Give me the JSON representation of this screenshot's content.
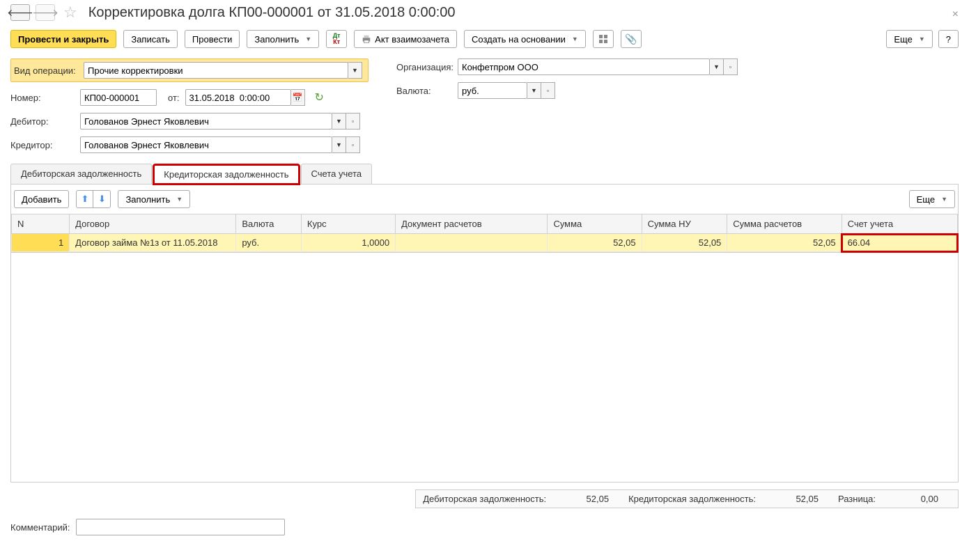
{
  "header": {
    "title": "Корректировка долга КП00-000001 от 31.05.2018 0:00:00"
  },
  "toolbar": {
    "post_close": "Провести и закрыть",
    "save": "Записать",
    "post": "Провести",
    "fill": "Заполнить",
    "offset_act": "Акт взаимозачета",
    "create_based": "Создать на основании",
    "more": "Еще",
    "help": "?"
  },
  "form": {
    "operation_type_label": "Вид операции:",
    "operation_type": "Прочие корректировки",
    "number_label": "Номер:",
    "number": "КП00-000001",
    "date_label": "от:",
    "date": "31.05.2018  0:00:00",
    "debtor_label": "Дебитор:",
    "debtor": "Голованов Эрнест Яковлевич",
    "creditor_label": "Кредитор:",
    "creditor": "Голованов Эрнест Яковлевич",
    "org_label": "Организация:",
    "org": "Конфетпром ООО",
    "currency_label": "Валюта:",
    "currency": "руб."
  },
  "tabs": {
    "receivables": "Дебиторская задолженность",
    "payables": "Кредиторская задолженность",
    "accounts": "Счета учета"
  },
  "subtoolbar": {
    "add": "Добавить",
    "fill": "Заполнить",
    "more": "Еще"
  },
  "table": {
    "headers": {
      "n": "N",
      "contract": "Договор",
      "currency": "Валюта",
      "rate": "Курс",
      "doc": "Документ расчетов",
      "sum": "Сумма",
      "sum_nu": "Сумма НУ",
      "sum_calc": "Сумма расчетов",
      "account": "Счет учета"
    },
    "rows": [
      {
        "n": "1",
        "contract": "Договор займа №1з от 11.05.2018",
        "currency": "руб.",
        "rate": "1,0000",
        "doc": "",
        "sum": "52,05",
        "sum_nu": "52,05",
        "sum_calc": "52,05",
        "account": "66.04"
      }
    ]
  },
  "summary": {
    "receivables_label": "Дебиторская задолженность:",
    "receivables_value": "52,05",
    "payables_label": "Кредиторская задолженность:",
    "payables_value": "52,05",
    "diff_label": "Разница:",
    "diff_value": "0,00"
  },
  "comment": {
    "label": "Комментарий:",
    "value": ""
  }
}
